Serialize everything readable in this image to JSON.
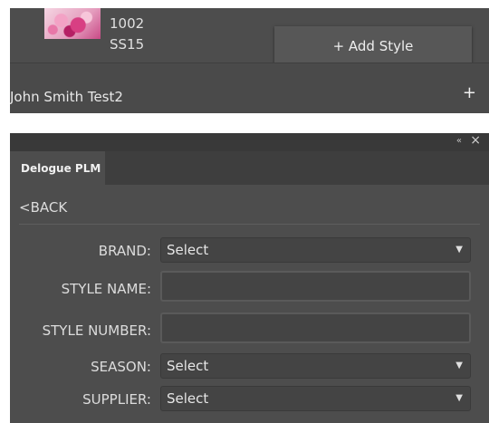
{
  "top_panel": {
    "meta_partial": "…",
    "style_number": "1002",
    "season": "SS15",
    "add_style_label": "+ Add Style",
    "user_name": "John Smith Test2",
    "user_add_label": "+"
  },
  "window": {
    "collapse_glyph": "«",
    "close_glyph": "×",
    "tab_label": "Delogue PLM",
    "back_label": "<BACK"
  },
  "form": {
    "brand_label": "BRAND:",
    "brand_value": "Select",
    "style_name_label": "STYLE NAME:",
    "style_name_value": "",
    "style_number_label": "STYLE NUMBER:",
    "style_number_value": "",
    "season_label": "SEASON:",
    "season_value": "Select",
    "supplier_label": "SUPPLIER:",
    "supplier_value": "Select",
    "caret_glyph": "▼"
  }
}
